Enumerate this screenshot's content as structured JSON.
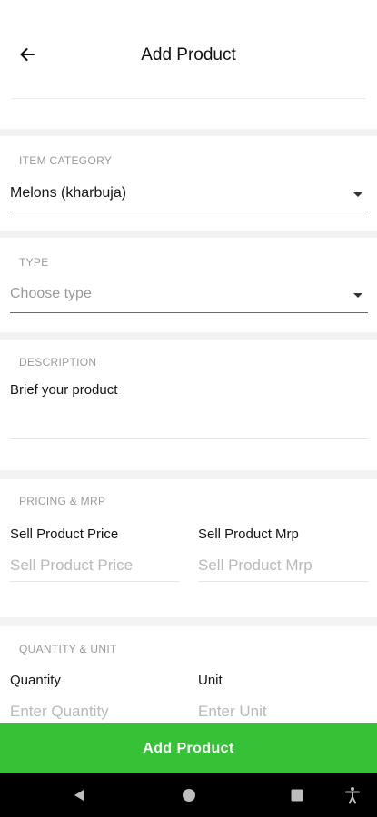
{
  "header": {
    "title": "Add Product",
    "back_icon": "arrow-left-icon"
  },
  "item_category": {
    "label": "ITEM CATEGORY",
    "value": "Melons (kharbuja)"
  },
  "type": {
    "label": "TYPE",
    "placeholder": "Choose type"
  },
  "description": {
    "label": "DESCRIPTION",
    "placeholder": "Brief your product"
  },
  "pricing": {
    "label": "PRICING & MRP",
    "price_title": "Sell Product Price",
    "price_placeholder": "Sell Product Price",
    "mrp_title": "Sell Product Mrp",
    "mrp_placeholder": "Sell Product Mrp"
  },
  "quantity": {
    "label": "QUANTITY & UNIT",
    "quantity_title": "Quantity",
    "quantity_placeholder": "Enter Quantity",
    "unit_title": "Unit",
    "unit_placeholder": "Enter Unit"
  },
  "submit": {
    "label": "Add Product",
    "color": "#35c237"
  },
  "system_nav": {
    "icons": [
      "back-triangle-icon",
      "home-circle-icon",
      "recents-square-icon",
      "accessibility-icon"
    ]
  }
}
